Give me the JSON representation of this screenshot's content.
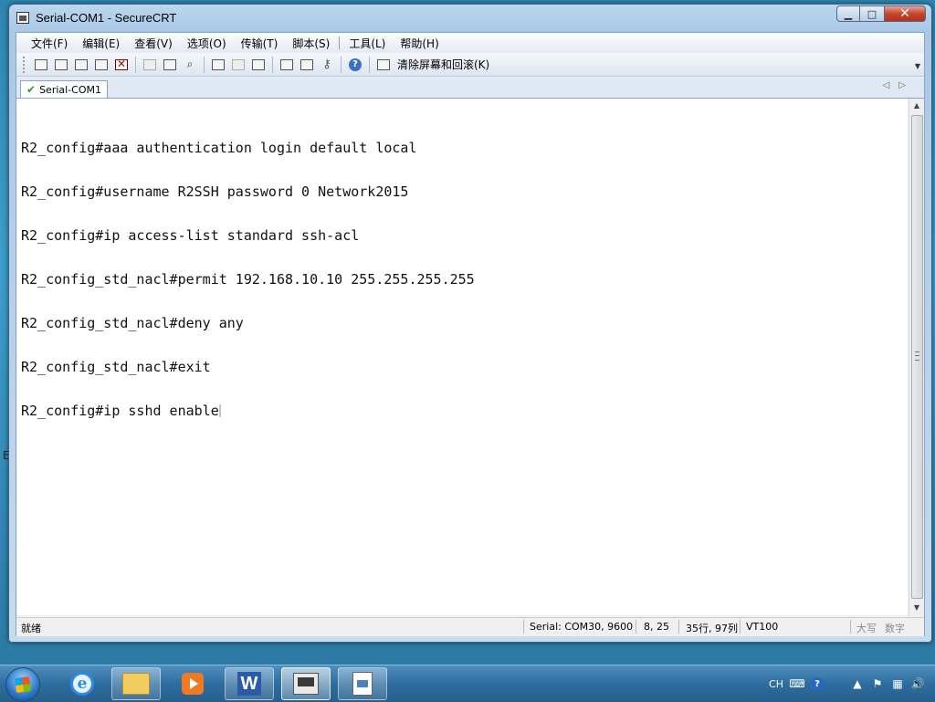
{
  "window": {
    "title": "Serial-COM1 - SecureCRT",
    "minimize": "▁",
    "maximize": "□",
    "close": "✕"
  },
  "menu": {
    "items": [
      "文件(F)",
      "编辑(E)",
      "查看(V)",
      "选项(O)",
      "传输(T)",
      "脚本(S)",
      "工具(L)",
      "帮助(H)"
    ]
  },
  "toolbar": {
    "clear_label": "清除屏幕和回滚(K)",
    "help_glyph": "?",
    "key_glyph": "⚷",
    "find_glyph": "⌕",
    "overflow_glyph": "▼"
  },
  "tabs": {
    "active_label": "Serial-COM1",
    "check_glyph": "✔",
    "arrows": "◁▷"
  },
  "terminal": {
    "lines": [
      "R2_config#aaa authentication login default local",
      "R2_config#username R2SSH password 0 Network2015",
      "R2_config#ip access-list standard ssh-acl",
      "R2_config_std_nacl#permit 192.168.10.10 255.255.255.255",
      "R2_config_std_nacl#deny any",
      "R2_config_std_nacl#exit",
      "R2_config#ip sshd enable"
    ]
  },
  "scrollbar": {
    "up": "▲",
    "down": "▼"
  },
  "status": {
    "ready": "就绪",
    "connection": "Serial: COM30, 9600",
    "cursor_pos": "8,  25",
    "size": "35行, 97列",
    "emulation": "VT100",
    "caps": "大写",
    "num": "数字"
  },
  "desktop": {
    "left_edge_mark": "E"
  },
  "taskbar": {
    "ie_letter": "e",
    "word_letter": "W",
    "tray_lang": "CH",
    "tray_help": "?",
    "tray_flag": "⚑",
    "tray_arrow": "▲",
    "tray_volume": "🔊",
    "tray_keyboard": "⌨",
    "tray_network": "▦"
  }
}
